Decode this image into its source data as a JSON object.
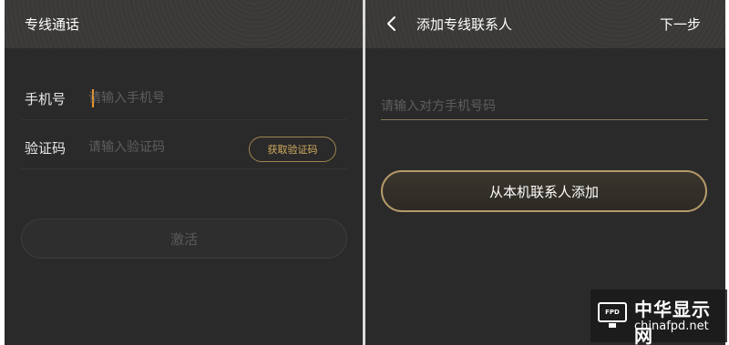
{
  "left_screen": {
    "header": {
      "title": "专线通话"
    },
    "phone_row": {
      "label": "手机号",
      "placeholder": "请输入手机号"
    },
    "code_row": {
      "label": "验证码",
      "placeholder": "请输入验证码",
      "get_code_label": "获取验证码"
    },
    "activate_label": "激活"
  },
  "right_screen": {
    "header": {
      "title": "添加专线联系人",
      "next_label": "下一步",
      "back_icon": "chevron-left-icon"
    },
    "contact_placeholder": "请输入对方手机号码",
    "add_from_contacts_label": "从本机联系人添加"
  },
  "watermark": {
    "logo_text": "FPD",
    "name_cn": "中华显示网",
    "url": "chinafpd.net"
  },
  "colors": {
    "background": "#2a2a2a",
    "header": "#3a3937",
    "accent_gold": "#b59a68",
    "caret_orange": "#e8952a",
    "text": "#ffffff",
    "placeholder": "#5e5e5e"
  }
}
